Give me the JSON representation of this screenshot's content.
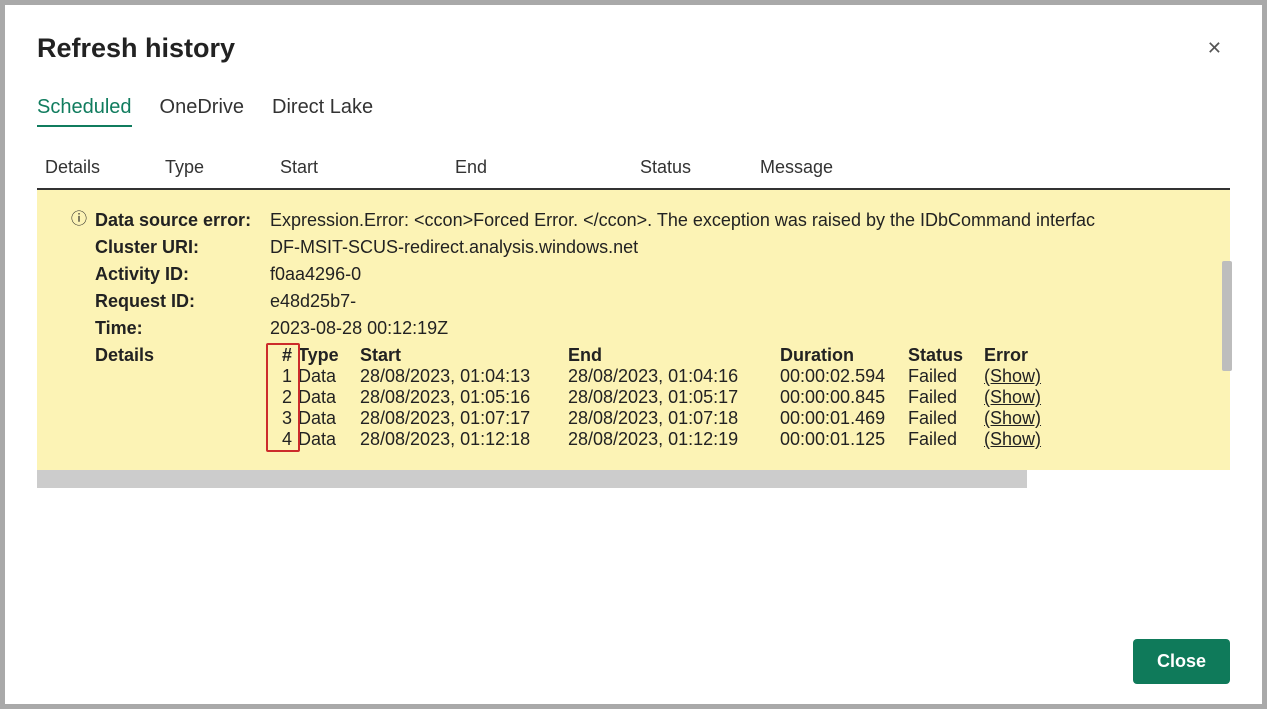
{
  "title": "Refresh history",
  "tabs": [
    "Scheduled",
    "OneDrive",
    "Direct Lake"
  ],
  "activeTab": 0,
  "outerHeaders": [
    "Details",
    "Type",
    "Start",
    "End",
    "Status",
    "Message"
  ],
  "error": {
    "dataSourceErrorLabel": "Data source error:",
    "dataSourceErrorValue": "Expression.Error: <ccon>Forced Error. </ccon>. The exception was raised by the IDbCommand interfac",
    "clusterUriLabel": "Cluster URI:",
    "clusterUriValue": "DF-MSIT-SCUS-redirect.analysis.windows.net",
    "activityIdLabel": "Activity ID:",
    "activityIdValue": "f0aa4296-0",
    "requestIdLabel": "Request ID:",
    "requestIdValue": "e48d25b7-",
    "timeLabel": "Time:",
    "timeValue": "2023-08-28 00:12:19Z",
    "detailsLabel": "Details"
  },
  "detailHeaders": {
    "num": "#",
    "type": "Type",
    "start": "Start",
    "end": "End",
    "duration": "Duration",
    "status": "Status",
    "error": "Error"
  },
  "detailRows": [
    {
      "num": "1",
      "type": "Data",
      "start": "28/08/2023, 01:04:13",
      "end": "28/08/2023, 01:04:16",
      "duration": "00:00:02.594",
      "status": "Failed",
      "error": "(Show)"
    },
    {
      "num": "2",
      "type": "Data",
      "start": "28/08/2023, 01:05:16",
      "end": "28/08/2023, 01:05:17",
      "duration": "00:00:00.845",
      "status": "Failed",
      "error": "(Show)"
    },
    {
      "num": "3",
      "type": "Data",
      "start": "28/08/2023, 01:07:17",
      "end": "28/08/2023, 01:07:18",
      "duration": "00:00:01.469",
      "status": "Failed",
      "error": "(Show)"
    },
    {
      "num": "4",
      "type": "Data",
      "start": "28/08/2023, 01:12:18",
      "end": "28/08/2023, 01:12:19",
      "duration": "00:00:01.125",
      "status": "Failed",
      "error": "(Show)"
    }
  ],
  "closeButton": "Close"
}
